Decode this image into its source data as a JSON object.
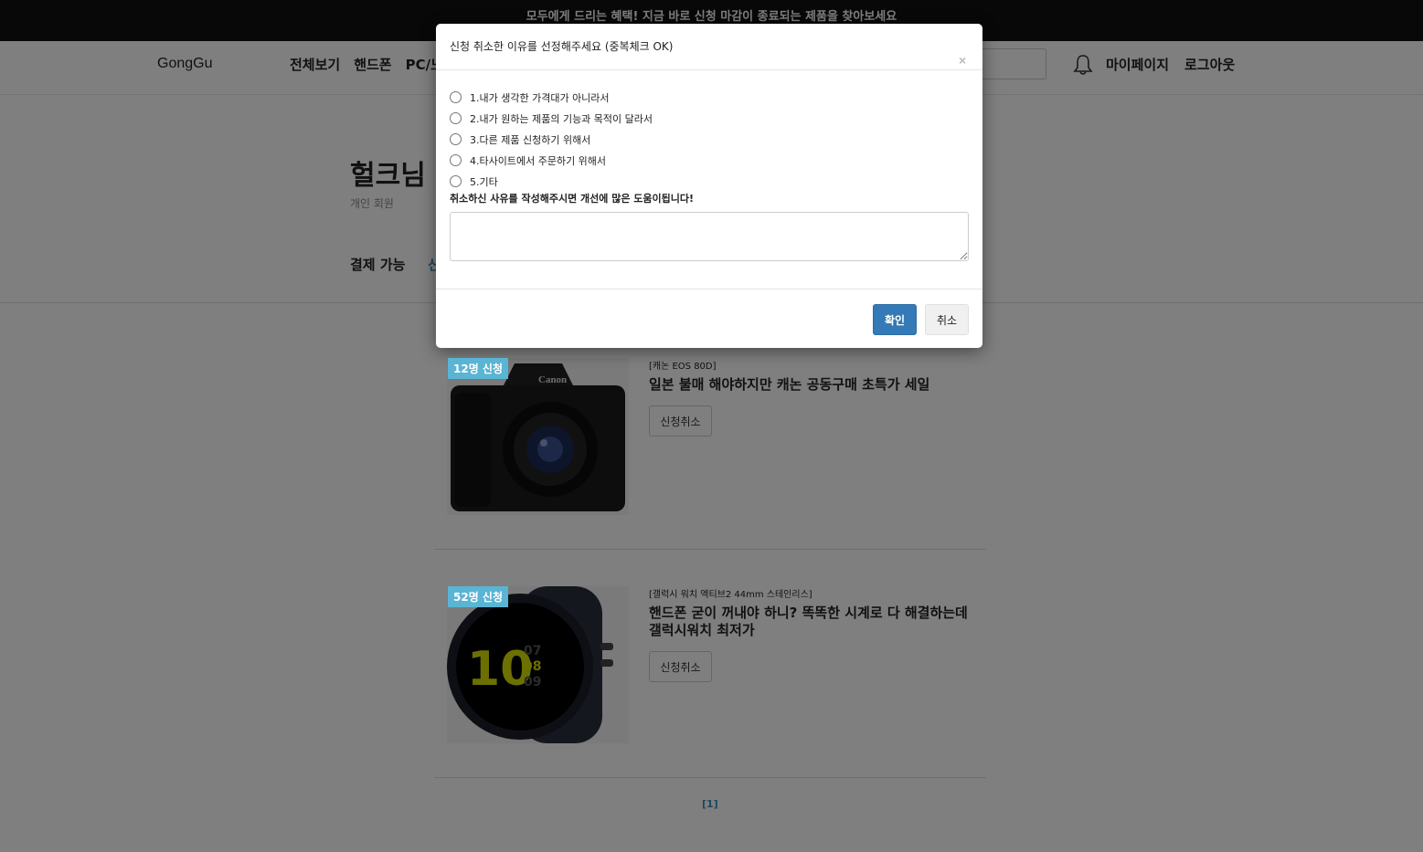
{
  "banner": {
    "text": "모두에게 드리는 혜택! 지금 바로 신청 마감이 종료되는 제품을 찾아보세요"
  },
  "header": {
    "logo": "GongGu",
    "nav": [
      "전체보기",
      "핸드폰",
      "PC/노"
    ],
    "mypage": "마이페이지",
    "logout": "로그아웃"
  },
  "profile": {
    "name": "헐크님",
    "type": "개인 회원",
    "tab_pay": "결제 가능",
    "tab_apply": "신"
  },
  "products": [
    {
      "badge": "12명 신청",
      "brand": "[캐논 EOS 80D]",
      "title": "일본 불매 해야하지만 캐논 공동구매 초특가 세일",
      "button": "신청취소"
    },
    {
      "badge": "52명 신청",
      "brand": "[갤럭시 워치 액티브2 44mm 스테인리스]",
      "title": "핸드폰 굳이 꺼내야 하니? 똑똑한 시계로 다 해결하는데 갤럭시워치 최저가",
      "button": "신청취소"
    }
  ],
  "pager": "[1]",
  "modal": {
    "title": "신청 취소한 이유를 선정해주세요 (중복체크 OK)",
    "close": "×",
    "options": [
      "1.내가 생각한 가격대가 아니라서",
      "2.내가 원하는 제품의 기능과 목적이 달라서",
      "3.다른 제품 신청하기 위해서",
      "4.타사이트에서 주문하기 위해서",
      "5.기타"
    ],
    "reason_label": "취소하신 사유를 작성해주시면 개선에 많은 도움이됩니다!",
    "confirm": "확인",
    "cancel": "취소"
  },
  "colors": {
    "accent": "#337ab7",
    "badge": "#5ab4d3",
    "banner": "#111111"
  },
  "icons": {
    "bell": "bell-icon",
    "close": "close-icon"
  }
}
